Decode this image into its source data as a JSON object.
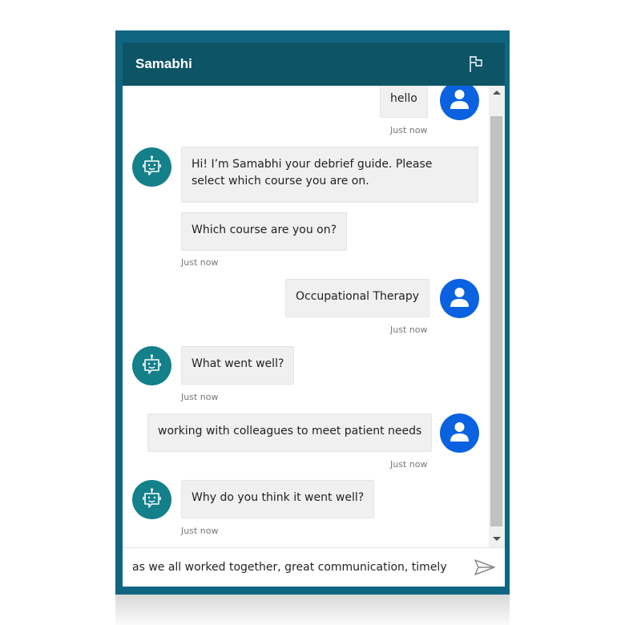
{
  "window": {
    "title": "Samabhi",
    "flag_icon": "flag-icon"
  },
  "messages": [
    {
      "from": "user",
      "text": "hello",
      "timestamp": "Just now"
    },
    {
      "from": "bot",
      "text": "Hi! I’m Samabhi your debrief guide. Please select which course you are on."
    },
    {
      "from": "bot",
      "text": "Which course are you on?",
      "timestamp": "Just now"
    },
    {
      "from": "user",
      "text": "Occupational Therapy",
      "timestamp": "Just now"
    },
    {
      "from": "bot",
      "text": "What went well?",
      "timestamp": "Just now"
    },
    {
      "from": "user",
      "text": "working with colleagues to meet patient needs",
      "timestamp": "Just now"
    },
    {
      "from": "bot",
      "text": "Why do you think it went well?",
      "timestamp": "Just now"
    }
  ],
  "input": {
    "value": "as we all worked together, great communication, timely",
    "send_icon": "send-icon"
  },
  "colors": {
    "header": "#0d5467",
    "frame": "#0f6680",
    "user_avatar": "#0a62e0",
    "bot_avatar": "#14808a"
  }
}
